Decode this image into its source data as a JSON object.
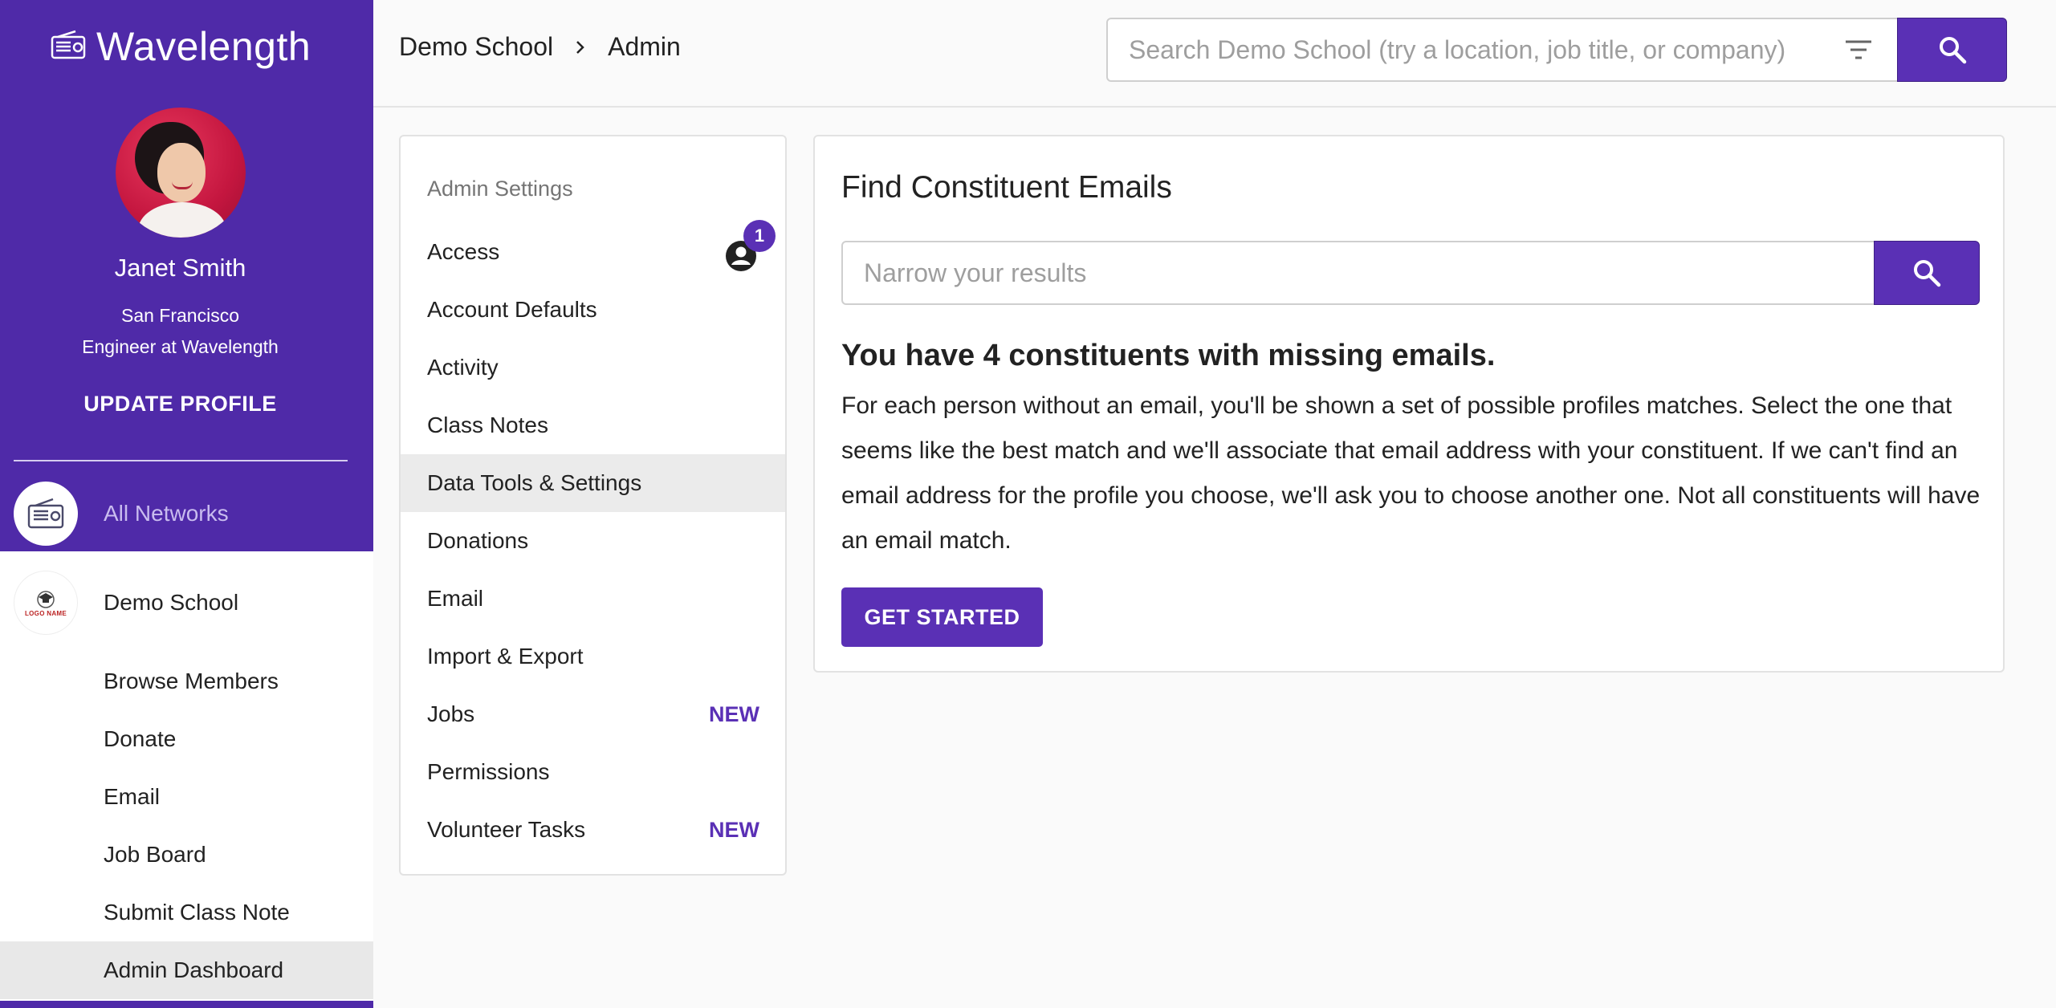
{
  "app": {
    "brand_name": "Wavelength",
    "accent_color": "#5a30b5",
    "sidebar_color": "#4f2aa8"
  },
  "profile": {
    "name": "Janet Smith",
    "location": "San Francisco",
    "job": "Engineer at Wavelength",
    "update_label": "UPDATE PROFILE"
  },
  "sidebar": {
    "all_networks_label": "All Networks",
    "school_name": "Demo School",
    "school_logo_text": "LOGO NAME",
    "items": [
      {
        "label": "Browse Members",
        "icon": "none"
      },
      {
        "label": "Donate",
        "icon": "none"
      },
      {
        "label": "Email",
        "icon": "none"
      },
      {
        "label": "Job Board",
        "icon": "none"
      },
      {
        "label": "Submit Class Note",
        "icon": "none"
      },
      {
        "label": "Admin Dashboard",
        "icon": "none",
        "active": true
      }
    ]
  },
  "header": {
    "breadcrumb": [
      "Demo School",
      "Admin"
    ],
    "search_placeholder": "Search Demo School (try a location, job title, or company)",
    "search_value": ""
  },
  "settings": {
    "title": "Admin Settings",
    "access_badge_count": "1",
    "items": [
      {
        "label": "Access",
        "tag": ""
      },
      {
        "label": "Account Defaults",
        "tag": ""
      },
      {
        "label": "Activity",
        "tag": ""
      },
      {
        "label": "Class Notes",
        "tag": ""
      },
      {
        "label": "Data Tools & Settings",
        "tag": "",
        "active": true
      },
      {
        "label": "Donations",
        "tag": ""
      },
      {
        "label": "Email",
        "tag": ""
      },
      {
        "label": "Import & Export",
        "tag": ""
      },
      {
        "label": "Jobs",
        "tag": "NEW"
      },
      {
        "label": "Permissions",
        "tag": ""
      },
      {
        "label": "Volunteer Tasks",
        "tag": "NEW"
      }
    ]
  },
  "main": {
    "title": "Find Constituent Emails",
    "narrow_placeholder": "Narrow your results",
    "narrow_value": "",
    "missing_heading": "You have 4 constituents with missing emails.",
    "description": "For each person without an email, you'll be shown a set of possible profiles matches. Select the one that seems like the best match and we'll associate that email address with your constituent. If we can't find an email address for the profile you choose, we'll ask you to choose another one. Not all constituents will have an email match.",
    "get_started_label": "GET STARTED"
  }
}
